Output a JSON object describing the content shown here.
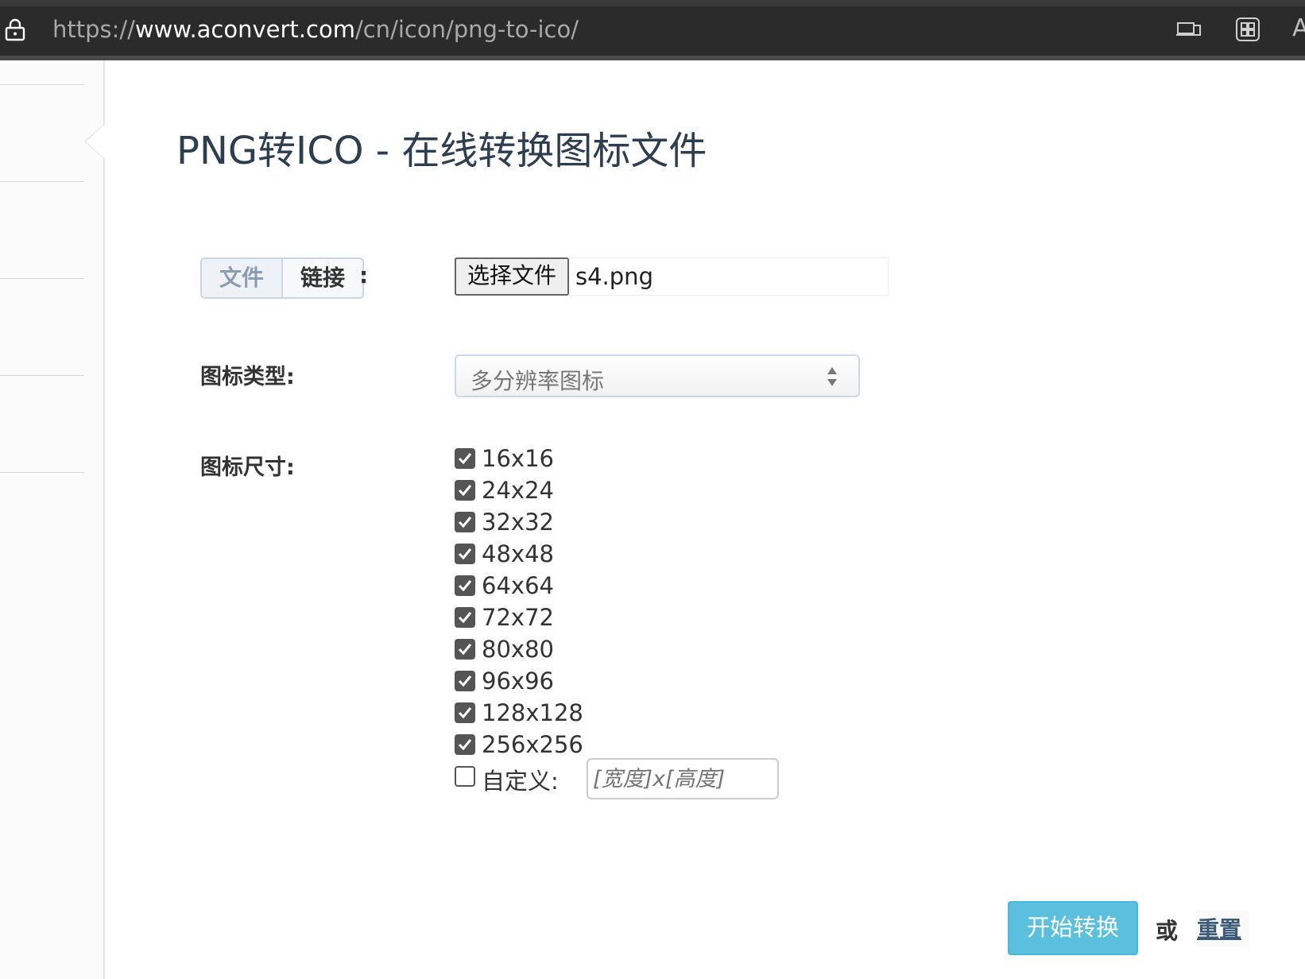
{
  "browser": {
    "url_prefix": "https://",
    "url_host": "www.aconvert.com",
    "url_path": "/cn/icon/png-to-ico/",
    "toolbar_letter": "A"
  },
  "page": {
    "title": "PNG转ICO - 在线转换图标文件"
  },
  "source": {
    "tab_file": "文件",
    "tab_link": "链接",
    "colon": ":",
    "file_button": "选择文件",
    "file_name": "s4.png"
  },
  "icon_type": {
    "label": "图标类型:",
    "selected": "多分辨率图标"
  },
  "icon_size": {
    "label": "图标尺寸:",
    "options": [
      {
        "label": "16x16",
        "checked": true
      },
      {
        "label": "24x24",
        "checked": true
      },
      {
        "label": "32x32",
        "checked": true
      },
      {
        "label": "48x48",
        "checked": true
      },
      {
        "label": "64x64",
        "checked": true
      },
      {
        "label": "72x72",
        "checked": true
      },
      {
        "label": "80x80",
        "checked": true
      },
      {
        "label": "96x96",
        "checked": true
      },
      {
        "label": "128x128",
        "checked": true
      },
      {
        "label": "256x256",
        "checked": true
      }
    ],
    "custom_label": "自定义:",
    "custom_checked": false,
    "custom_placeholder": "[宽度]x[高度]"
  },
  "actions": {
    "convert": "开始转换",
    "or": "或",
    "reset": "重置"
  },
  "colors": {
    "browser_bar": "#2b2b2b",
    "title": "#2d3e50",
    "convert_button": "#5bc0de"
  }
}
